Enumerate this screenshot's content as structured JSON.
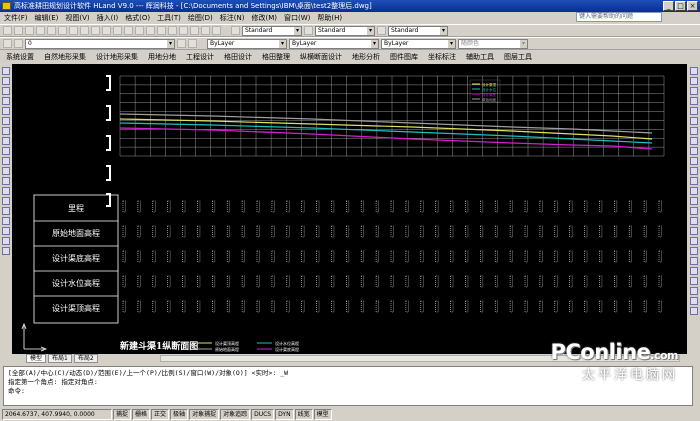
{
  "title_bar": {
    "text": "高标准耕田规划设计软件 HLand V9.0 --- 辉润科技 - [C:\\Documents and Settings\\IBM\\桌面\\test2整理后.dwg]",
    "buttons": [
      "_",
      "□",
      "×"
    ]
  },
  "menu": [
    "文件(F)",
    "编辑(E)",
    "视图(V)",
    "插入(I)",
    "格式(O)",
    "工具(T)",
    "绘图(D)",
    "标注(N)",
    "修改(M)",
    "窗口(W)",
    "帮助(H)"
  ],
  "help_placeholder": "键入需要帮助的问题",
  "toolbar": {
    "text_style": "Standard",
    "dim_style": "Standard",
    "table_style": "Standard",
    "layer": "0",
    "color": "ByLayer",
    "linetype": "ByLayer",
    "lineweight": "ByLayer",
    "plotstyle": "随颜色"
  },
  "ribbon": [
    "系统设置",
    "自然地形采集",
    "设计地形采集",
    "用地分地",
    "工程设计",
    "格田设计",
    "格田整理",
    "纵横断面设计",
    "地形分析",
    "图件图库",
    "坐标标注",
    "辅助工具",
    "图层工具"
  ],
  "drawing": {
    "row_labels": [
      "里程",
      "原始地面高程",
      "设计渠底高程",
      "设计水位高程",
      "设计渠顶高程"
    ],
    "chart_title": "新建斗渠1纵断面图",
    "legend_top": [
      "设计渠顶",
      "设计水位",
      "设计渠底",
      "原始地面"
    ],
    "legend_bottom": [
      "设计渠顶高程",
      "原始地面高程",
      "设计水位高程",
      "设计渠底高程"
    ]
  },
  "layout_tabs": [
    "模型",
    "布局1",
    "布局2"
  ],
  "command_lines": [
    "[全部(A)/中心(C)/动态(D)/范围(E)/上一个(P)/比例(S)/窗口(W)/对象(O)] <实时>: _W",
    "指定第一个角点: 指定对角点:",
    "命令:"
  ],
  "status": {
    "coords": "2064.6737,  407.9940,  0.0000",
    "toggles": [
      "捕捉",
      "栅格",
      "正交",
      "极轴",
      "对象捕捉",
      "对象追踪",
      "DUCS",
      "DYN",
      "线宽",
      "模型"
    ]
  },
  "watermark": {
    "brand": "PConline",
    "domain": ".com",
    "cn": "太平洋电脑网"
  }
}
